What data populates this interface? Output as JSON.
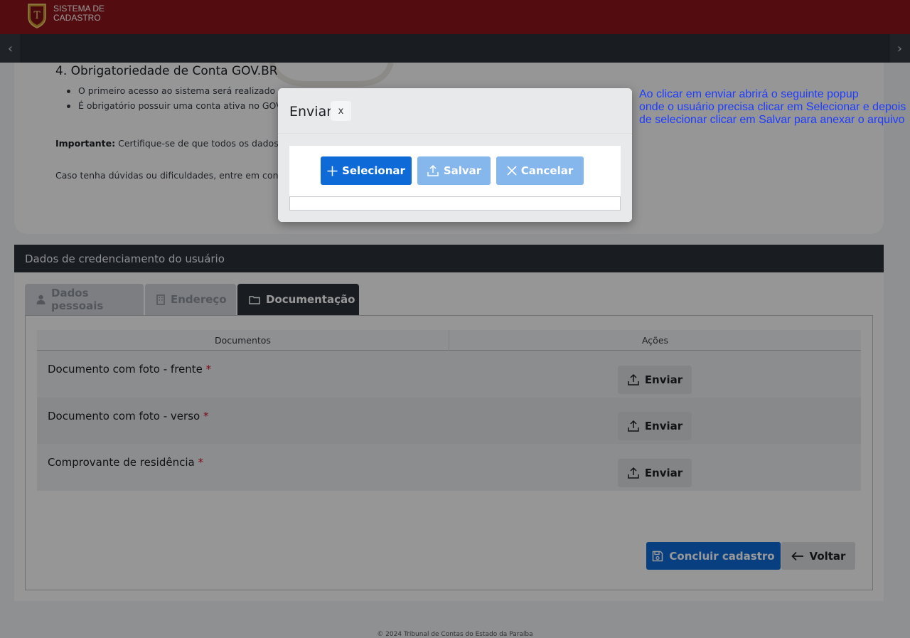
{
  "header": {
    "logo_text_line1": "SISTEMA DE",
    "logo_text_line2": "CADASTRO",
    "logo_icon": "tce-shield-logo",
    "brand_color": "#8b1419"
  },
  "navbar": {
    "prev_icon": "chevron-left-icon",
    "next_icon": "chevron-right-icon",
    "prev_glyph": "‹",
    "next_glyph": "›"
  },
  "info": {
    "title": "4. Obrigatoriedade de Conta GOV.BR",
    "bullets": [
      "O primeiro acesso ao sistema será realizado e",
      "É obrigatório possuir uma conta ativa no GOV"
    ],
    "important_label": "Importante:",
    "important_text": " Certifique-se de que todos os dados",
    "doubt_text": "Caso tenha dúvidas ou dificuldades, entre em cont"
  },
  "annotation": {
    "line1": "Ao clicar em enviar abrirá o seguinte popup",
    "line2": "onde o usuário precisa clicar em Selecionar e depois",
    "line3": "de selecionar clicar em Salvar para anexar o arquivo",
    "color": "#1e3cff"
  },
  "credential": {
    "header": "Dados de credenciamento do usuário",
    "tabs": [
      {
        "label": "Dados pessoais",
        "icon": "user-icon",
        "active": false
      },
      {
        "label": "Endereço",
        "icon": "building-icon",
        "active": false
      },
      {
        "label": "Documentação",
        "icon": "folder-icon",
        "active": true
      }
    ],
    "table": {
      "col_documents": "Documentos",
      "col_actions": "Ações",
      "rows": [
        {
          "label": "Documento com foto - frente",
          "required": "*",
          "action": "Enviar"
        },
        {
          "label": "Documento com foto - verso",
          "required": "*",
          "action": "Enviar"
        },
        {
          "label": "Comprovante de residência",
          "required": "*",
          "action": "Enviar"
        }
      ]
    },
    "finish_label": "Concluir cadastro",
    "back_label": "Voltar",
    "accent_color": "#0d6ad6"
  },
  "footer": {
    "text": "© 2024 Tribunal de Contas do Estado da Paraíba"
  },
  "dialog": {
    "title": "Enviar",
    "close_label": "x",
    "select_label": "Selecionar",
    "save_label": "Salvar",
    "cancel_label": "Cancelar"
  }
}
